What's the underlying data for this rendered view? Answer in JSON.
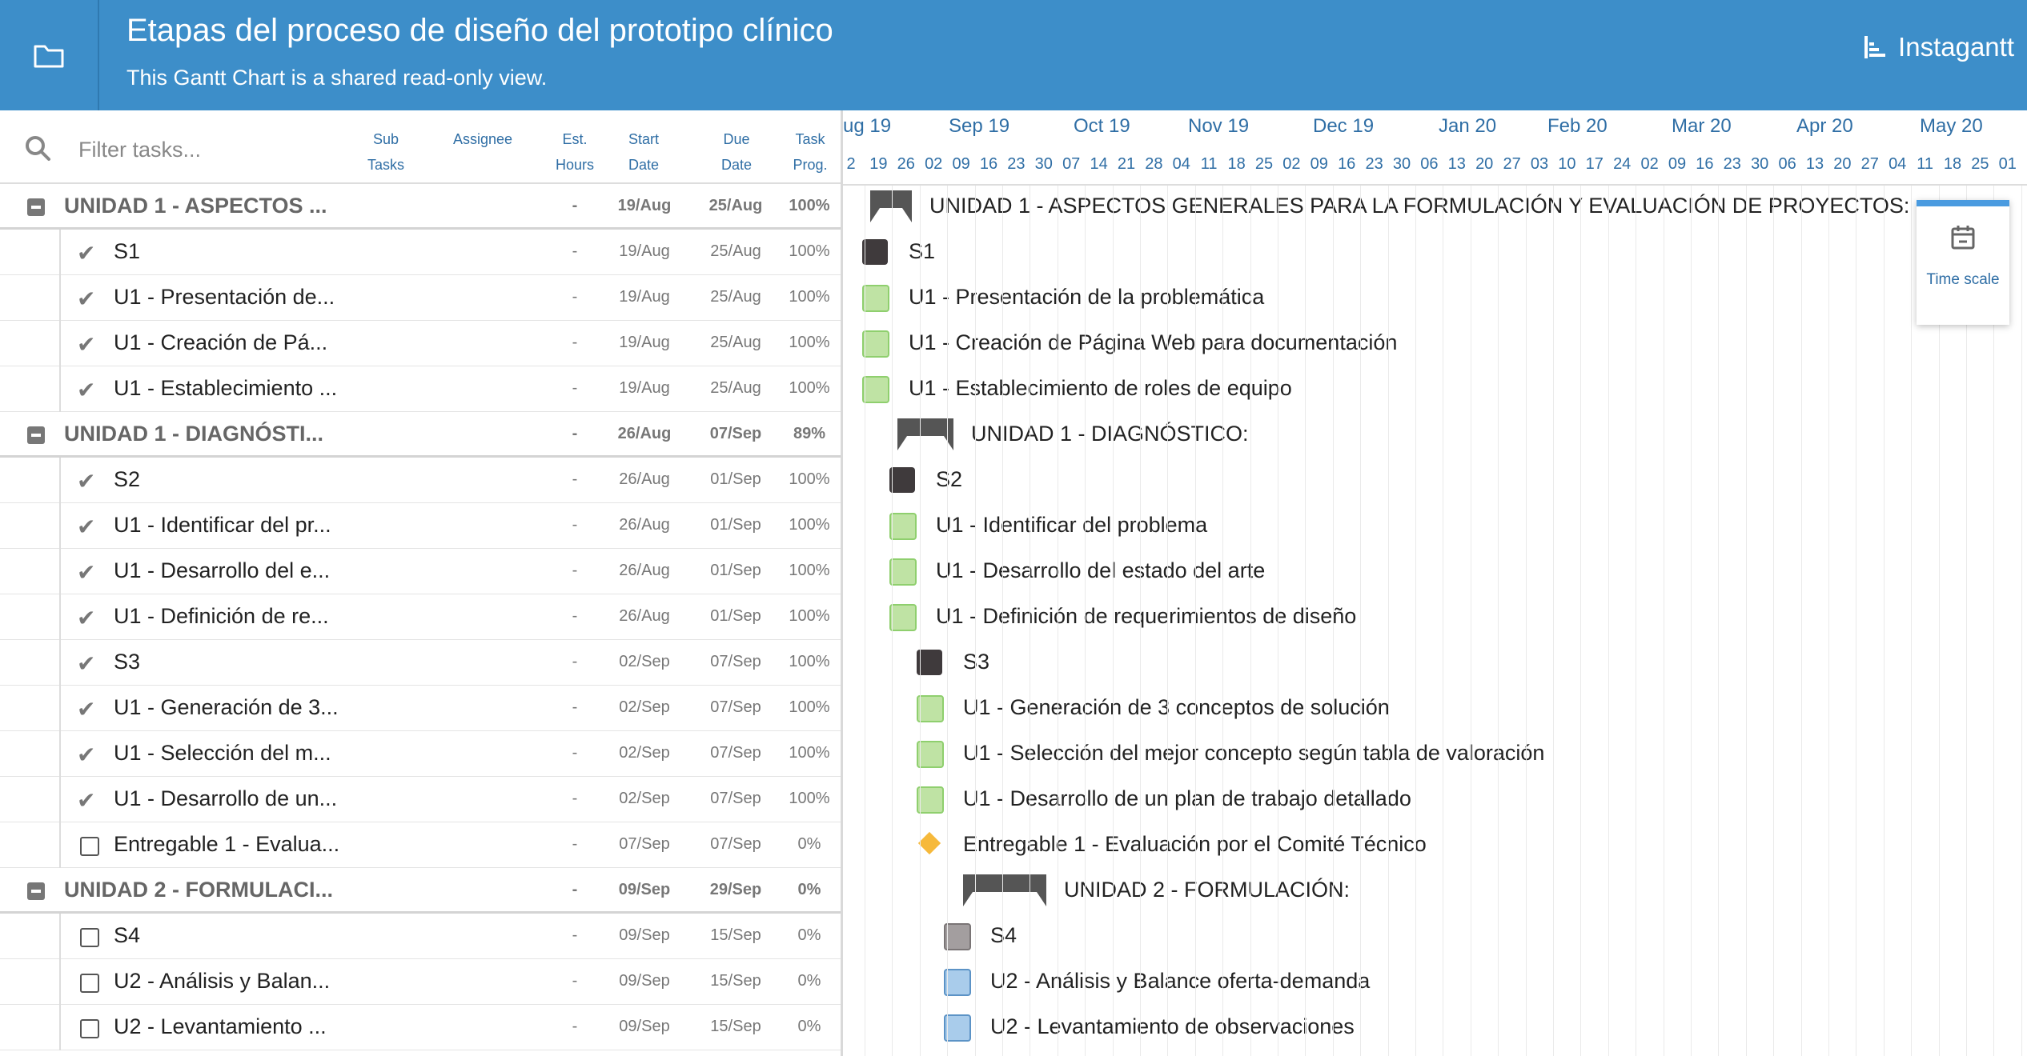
{
  "header": {
    "title": "Etapas del proceso de diseño del prototipo clínico",
    "subtitle": "This Gantt Chart is a shared read-only view.",
    "brand": "Instagantt"
  },
  "grid": {
    "filter_placeholder": "Filter tasks...",
    "columns": {
      "sub_tasks": "Sub Tasks",
      "assignee": "Assignee",
      "est_hours": "Est. Hours",
      "start_date": "Start Date",
      "due_date": "Due Date",
      "task_prog": "Task Prog."
    },
    "rows": [
      {
        "type": "group",
        "name": "UNIDAD 1 - ASPECTOS ...",
        "est": "-",
        "start": "19/Aug",
        "due": "25/Aug",
        "prog": "100%"
      },
      {
        "type": "task",
        "done": true,
        "name": "S1",
        "est": "-",
        "start": "19/Aug",
        "due": "25/Aug",
        "prog": "100%"
      },
      {
        "type": "task",
        "done": true,
        "name": "U1 - Presentación de...",
        "est": "-",
        "start": "19/Aug",
        "due": "25/Aug",
        "prog": "100%"
      },
      {
        "type": "task",
        "done": true,
        "name": "U1 - Creación de Pá...",
        "est": "-",
        "start": "19/Aug",
        "due": "25/Aug",
        "prog": "100%"
      },
      {
        "type": "task",
        "done": true,
        "name": "U1 - Establecimiento ...",
        "est": "-",
        "start": "19/Aug",
        "due": "25/Aug",
        "prog": "100%"
      },
      {
        "type": "group",
        "name": "UNIDAD 1 - DIAGNÓSTI...",
        "est": "-",
        "start": "26/Aug",
        "due": "07/Sep",
        "prog": "89%"
      },
      {
        "type": "task",
        "done": true,
        "name": "S2",
        "est": "-",
        "start": "26/Aug",
        "due": "01/Sep",
        "prog": "100%"
      },
      {
        "type": "task",
        "done": true,
        "name": "U1 - Identificar del pr...",
        "est": "-",
        "start": "26/Aug",
        "due": "01/Sep",
        "prog": "100%"
      },
      {
        "type": "task",
        "done": true,
        "name": "U1 - Desarrollo del e...",
        "est": "-",
        "start": "26/Aug",
        "due": "01/Sep",
        "prog": "100%"
      },
      {
        "type": "task",
        "done": true,
        "name": "U1 - Definición de re...",
        "est": "-",
        "start": "26/Aug",
        "due": "01/Sep",
        "prog": "100%"
      },
      {
        "type": "task",
        "done": true,
        "name": "S3",
        "est": "-",
        "start": "02/Sep",
        "due": "07/Sep",
        "prog": "100%"
      },
      {
        "type": "task",
        "done": true,
        "name": "U1 - Generación de 3...",
        "est": "-",
        "start": "02/Sep",
        "due": "07/Sep",
        "prog": "100%"
      },
      {
        "type": "task",
        "done": true,
        "name": "U1 - Selección del m...",
        "est": "-",
        "start": "02/Sep",
        "due": "07/Sep",
        "prog": "100%"
      },
      {
        "type": "task",
        "done": true,
        "name": "U1 - Desarrollo de un...",
        "est": "-",
        "start": "02/Sep",
        "due": "07/Sep",
        "prog": "100%"
      },
      {
        "type": "task",
        "done": false,
        "name": "Entregable 1 - Evalua...",
        "est": "-",
        "start": "07/Sep",
        "due": "07/Sep",
        "prog": "0%"
      },
      {
        "type": "group",
        "name": "UNIDAD 2 - FORMULACI...",
        "est": "-",
        "start": "09/Sep",
        "due": "29/Sep",
        "prog": "0%"
      },
      {
        "type": "task",
        "done": false,
        "name": "S4",
        "est": "-",
        "start": "09/Sep",
        "due": "15/Sep",
        "prog": "0%"
      },
      {
        "type": "task",
        "done": false,
        "name": "U2 - Análisis y Balan...",
        "est": "-",
        "start": "09/Sep",
        "due": "15/Sep",
        "prog": "0%"
      },
      {
        "type": "task",
        "done": false,
        "name": "U2 - Levantamiento ...",
        "est": "-",
        "start": "09/Sep",
        "due": "15/Sep",
        "prog": "0%"
      }
    ]
  },
  "timeline": {
    "months": [
      "ug 19",
      "Sep 19",
      "Oct 19",
      "Nov 19",
      "Dec 19",
      "Jan 20",
      "Feb 20",
      "Mar 20",
      "Apr 20",
      "May 20"
    ],
    "days": [
      "2",
      "19",
      "26",
      "02",
      "09",
      "16",
      "23",
      "30",
      "07",
      "14",
      "21",
      "28",
      "04",
      "11",
      "18",
      "25",
      "02",
      "09",
      "16",
      "23",
      "30",
      "06",
      "13",
      "20",
      "27",
      "03",
      "10",
      "17",
      "24",
      "02",
      "09",
      "16",
      "23",
      "30",
      "06",
      "13",
      "20",
      "27",
      "04",
      "11",
      "18",
      "25",
      "01"
    ],
    "items": [
      {
        "kind": "summary",
        "label": "UNIDAD 1 - ASPECTOS GENERALES PARA LA FORMULACIÓN Y EVALUACIÓN DE PROYECTOS:"
      },
      {
        "kind": "sep",
        "label": "S1"
      },
      {
        "kind": "task",
        "label": "U1 - Presentación de la problemática"
      },
      {
        "kind": "task",
        "label": "U1 - Creación de Página Web para documentación"
      },
      {
        "kind": "task",
        "label": "U1 - Establecimiento de roles de equipo"
      },
      {
        "kind": "summary",
        "label": "UNIDAD 1 - DIAGNÓSTICO:"
      },
      {
        "kind": "sep",
        "label": "S2"
      },
      {
        "kind": "task",
        "label": "U1 - Identificar del problema"
      },
      {
        "kind": "task",
        "label": "U1 - Desarrollo del estado del arte"
      },
      {
        "kind": "task",
        "label": "U1 - Definición de requerimientos de diseño"
      },
      {
        "kind": "sep",
        "label": "S3"
      },
      {
        "kind": "task",
        "label": "U1 - Generación de 3 conceptos de solución"
      },
      {
        "kind": "task",
        "label": "U1 - Selección del mejor concepto según tabla de valoración"
      },
      {
        "kind": "task",
        "label": "U1 - Desarrollo de un plan de trabajo detallado"
      },
      {
        "kind": "milestone",
        "label": "Entregable 1 - Evaluación por el Comité Técnico"
      },
      {
        "kind": "summary",
        "label": "UNIDAD 2 - FORMULACIÓN:"
      },
      {
        "kind": "sep-pending",
        "label": "S4"
      },
      {
        "kind": "task-pending",
        "label": "U2 - Análisis y Balance oferta-demanda"
      },
      {
        "kind": "task-pending",
        "label": "U2 - Levantamiento de observaciones"
      }
    ],
    "timescale_label": "Time scale"
  },
  "colors": {
    "header_bg": "#3d8ec9",
    "section_bar": "#3f3a3c",
    "task_done": "#bfe3a4",
    "task_pending": "#a9cceb",
    "milestone": "#f6b93b"
  }
}
